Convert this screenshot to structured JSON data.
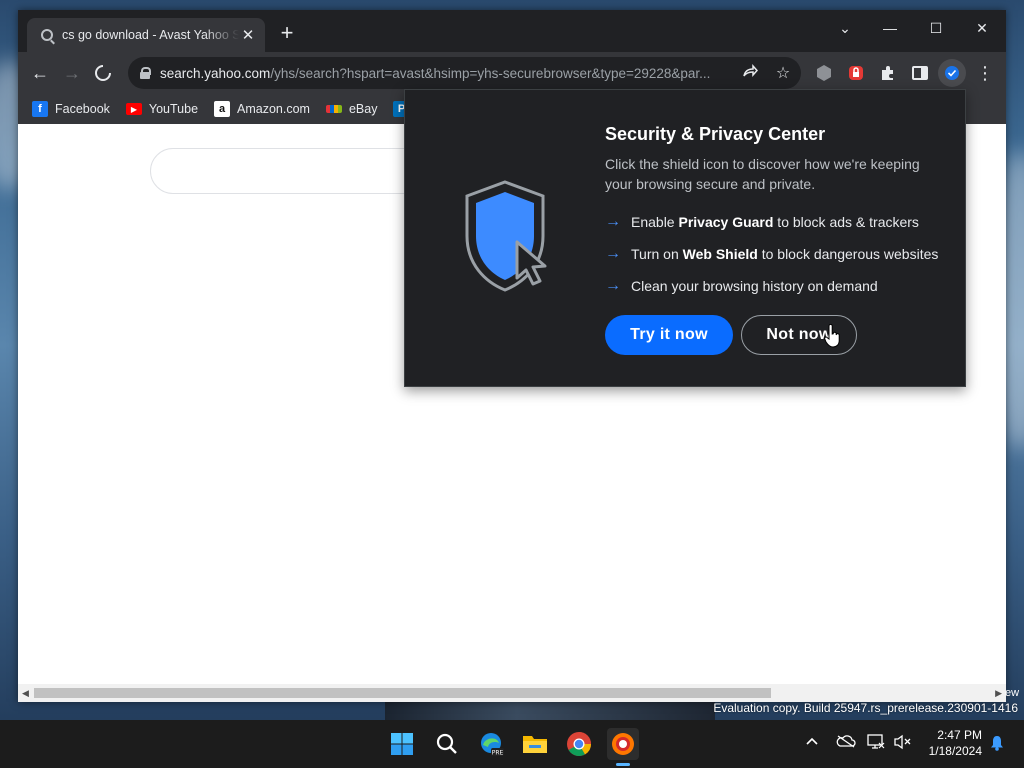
{
  "browser": {
    "tab_title": "cs go download - Avast Yahoo Search",
    "tab_close": "✕",
    "new_tab": "+",
    "window_controls": {
      "dropdown": "⌄",
      "minimize": "—",
      "maximize": "☐",
      "close": "✕"
    },
    "url_host": "search.yahoo.com",
    "url_path": "/yhs/search?hspart=avast&hsimp=yhs-securebrowser&type=29228&par...",
    "nav": {
      "back": "←",
      "forward": "→",
      "stop": "✕"
    }
  },
  "bookmarks": [
    {
      "label": "Facebook",
      "icon": "facebook-icon",
      "glyph": "f",
      "color": "#1877f2"
    },
    {
      "label": "YouTube",
      "icon": "youtube-icon",
      "glyph": "▶",
      "color": "#ff0000"
    },
    {
      "label": "Amazon.com",
      "icon": "amazon-icon",
      "glyph": "a",
      "color": "#ffffff"
    },
    {
      "label": "eBay",
      "icon": "ebay-icon",
      "glyph": "",
      "color": "#e53238"
    },
    {
      "label": "",
      "icon": "paypal-icon",
      "glyph": "P",
      "color": "#0070ba"
    }
  ],
  "popup": {
    "title": "Security & Privacy Center",
    "description": "Click the shield icon to discover how we're keeping your browsing secure and private.",
    "features": [
      {
        "pre": "Enable ",
        "bold": "Privacy Guard",
        "post": " to block ads & trackers"
      },
      {
        "pre": "Turn on ",
        "bold": "Web Shield",
        "post": " to block dangerous websites"
      },
      {
        "pre": "",
        "bold": "",
        "post": "Clean your browsing history on demand"
      }
    ],
    "primary_button": "Try it now",
    "secondary_button": "Not now"
  },
  "watermark": "Evaluation copy. Build 25947.rs_prerelease.230901-1416",
  "watermark_edge": "ew",
  "taskbar": {
    "apps": [
      "start-icon",
      "search-icon",
      "edge-beta-icon",
      "file-explorer-icon",
      "chrome-icon",
      "avast-browser-icon"
    ],
    "time": "2:47 PM",
    "date": "1/18/2024"
  },
  "colors": {
    "accent": "#0a6cff",
    "shield": "#3d8bff",
    "popup_bg": "#202124"
  }
}
